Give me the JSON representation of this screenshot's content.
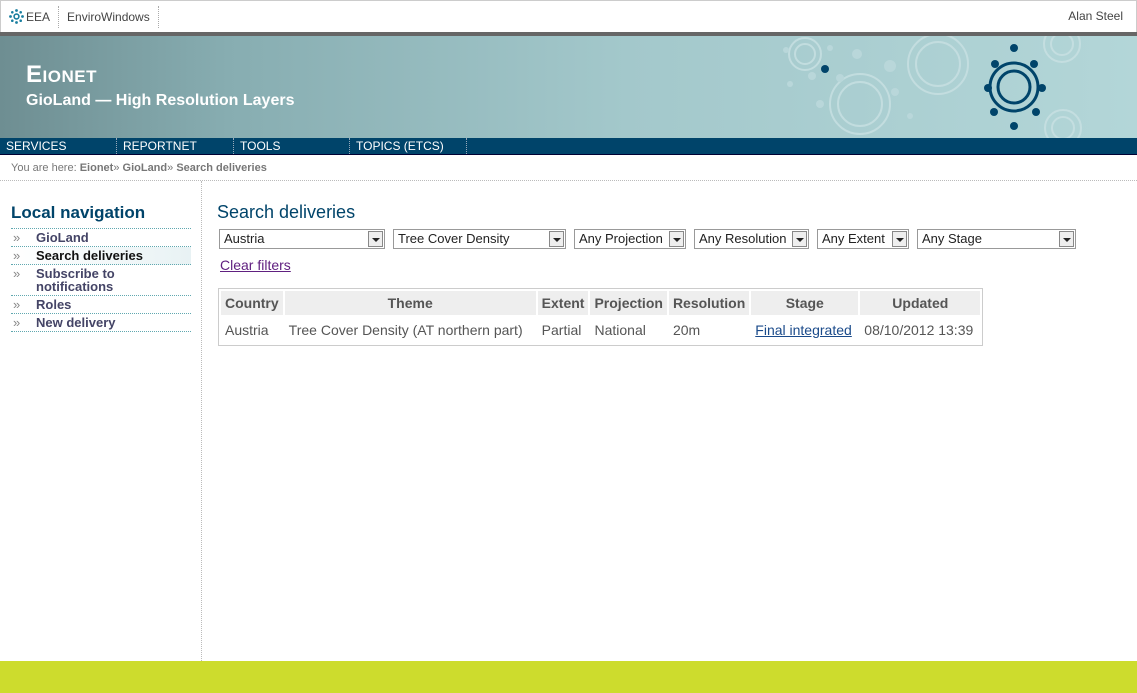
{
  "topbar": {
    "links": [
      {
        "label": "EEA",
        "icon": "eea-logo-icon"
      },
      {
        "label": "EnviroWindows"
      }
    ],
    "user": "Alan Steel"
  },
  "banner": {
    "title": "Eionet",
    "subtitle": "GioLand — High Resolution Layers"
  },
  "nav": [
    "SERVICES",
    "REPORTNET",
    "TOOLS",
    "TOPICS (ETCS)"
  ],
  "breadcrumb": {
    "prefix": "You are here: ",
    "items": [
      "Eionet",
      "GioLand",
      "Search deliveries"
    ]
  },
  "local_nav": {
    "heading": "Local navigation",
    "items": [
      {
        "label": "GioLand",
        "active": false
      },
      {
        "label": "Search deliveries",
        "active": true
      },
      {
        "label": "Subscribe to notifications",
        "active": false
      },
      {
        "label": "Roles",
        "active": false
      },
      {
        "label": "New delivery",
        "active": false
      }
    ]
  },
  "main": {
    "title": "Search deliveries",
    "filters": [
      "Austria",
      "Tree Cover Density",
      "Any Projection",
      "Any Resolution",
      "Any Extent",
      "Any Stage"
    ],
    "clear_filters": "Clear filters",
    "table": {
      "headers": [
        "Country",
        "Theme",
        "Extent",
        "Projection",
        "Resolution",
        "Stage",
        "Updated"
      ],
      "rows": [
        [
          "Austria",
          "Tree Cover Density (AT northern part)",
          "Partial",
          "National",
          "20m",
          "Final integrated",
          "08/10/2012 13:39"
        ]
      ]
    }
  },
  "colors": {
    "nav_bg": "#00446a",
    "footer_bg": "#cddc2d",
    "link": "#1a4a8a"
  }
}
